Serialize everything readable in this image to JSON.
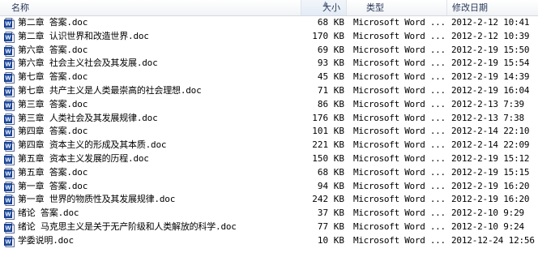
{
  "columns": {
    "name": "名称",
    "size": "大小",
    "type": "类型",
    "date": "修改日期"
  },
  "sort": {
    "column": "size",
    "indicator": "up-arrow"
  },
  "files": [
    {
      "name": "第二章 答案.doc",
      "size": "68 KB",
      "type": "Microsoft Word ...",
      "date": "2012-2-12 10:41",
      "icon": "word-document-icon"
    },
    {
      "name": "第二章 认识世界和改造世界.doc",
      "size": "170 KB",
      "type": "Microsoft Word ...",
      "date": "2012-2-12 10:39",
      "icon": "word-document-icon"
    },
    {
      "name": "第六章 答案.doc",
      "size": "69 KB",
      "type": "Microsoft Word ...",
      "date": "2012-2-19 15:50",
      "icon": "word-document-icon"
    },
    {
      "name": "第六章 社会主义社会及其发展.doc",
      "size": "93 KB",
      "type": "Microsoft Word ...",
      "date": "2012-2-19 15:54",
      "icon": "word-document-icon"
    },
    {
      "name": "第七章 答案.doc",
      "size": "45 KB",
      "type": "Microsoft Word ...",
      "date": "2012-2-19 14:39",
      "icon": "word-document-icon"
    },
    {
      "name": "第七章 共产主义是人类最崇高的社会理想.doc",
      "size": "71 KB",
      "type": "Microsoft Word ...",
      "date": "2012-2-19 16:04",
      "icon": "word-document-icon"
    },
    {
      "name": "第三章 答案.doc",
      "size": "86 KB",
      "type": "Microsoft Word ...",
      "date": "2012-2-13 7:39",
      "icon": "word-document-icon"
    },
    {
      "name": "第三章 人类社会及其发展规律.doc",
      "size": "176 KB",
      "type": "Microsoft Word ...",
      "date": "2012-2-13 7:38",
      "icon": "word-document-icon"
    },
    {
      "name": "第四章 答案.doc",
      "size": "101 KB",
      "type": "Microsoft Word ...",
      "date": "2012-2-14 22:10",
      "icon": "word-document-icon"
    },
    {
      "name": "第四章 资本主义的形成及其本质.doc",
      "size": "221 KB",
      "type": "Microsoft Word ...",
      "date": "2012-2-14 22:09",
      "icon": "word-document-icon"
    },
    {
      "name": "第五章  资本主义发展的历程.doc",
      "size": "150 KB",
      "type": "Microsoft Word ...",
      "date": "2012-2-19 15:12",
      "icon": "word-document-icon"
    },
    {
      "name": "第五章 答案.doc",
      "size": "68 KB",
      "type": "Microsoft Word ...",
      "date": "2012-2-19 15:15",
      "icon": "word-document-icon"
    },
    {
      "name": "第一章 答案.doc",
      "size": "94 KB",
      "type": "Microsoft Word ...",
      "date": "2012-2-19 16:20",
      "icon": "word-document-icon"
    },
    {
      "name": "第一章 世界的物质性及其发展规律.doc",
      "size": "242 KB",
      "type": "Microsoft Word ...",
      "date": "2012-2-19 16:20",
      "icon": "word-document-icon"
    },
    {
      "name": "绪论 答案.doc",
      "size": "37 KB",
      "type": "Microsoft Word ...",
      "date": "2012-2-10 9:29",
      "icon": "word-document-icon"
    },
    {
      "name": "绪论 马克思主义是关于无产阶级和人类解放的科学.doc",
      "size": "77 KB",
      "type": "Microsoft Word ...",
      "date": "2012-2-10 9:24",
      "icon": "word-document-icon"
    },
    {
      "name": "学委说明.doc",
      "size": "10 KB",
      "type": "Microsoft Word ...",
      "date": "2012-12-24 12:56",
      "icon": "word-document-icon"
    }
  ]
}
